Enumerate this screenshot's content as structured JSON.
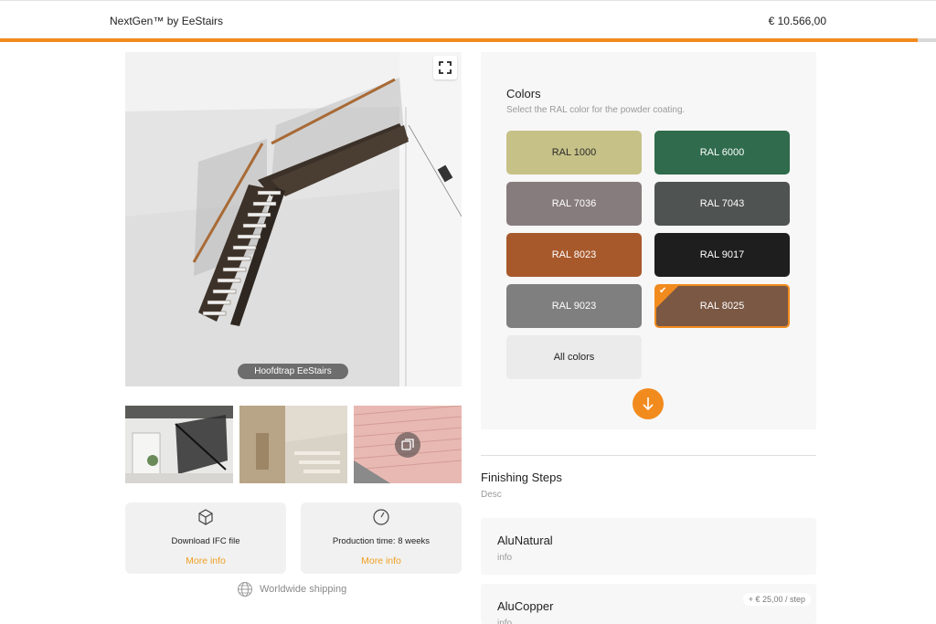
{
  "header": {
    "brand": "NextGen™ by EeStairs",
    "price": "€ 10.566,00",
    "progress_percent": 98
  },
  "viewer": {
    "label": "Hoofdtrap EeStairs",
    "fullscreen_icon": "expand-icon"
  },
  "thumbnails": [
    {
      "name": "thumbnail-interior-staircase"
    },
    {
      "name": "thumbnail-lobby-staircase"
    },
    {
      "name": "thumbnail-pink-detail",
      "icon": "gallery-icon"
    }
  ],
  "info_cards": [
    {
      "icon": "cube-icon",
      "label": "Download IFC file",
      "link": "More info"
    },
    {
      "icon": "clock-icon",
      "label": "Production time: 8 weeks",
      "link": "More info"
    }
  ],
  "shipping": {
    "icon": "globe-icon",
    "text": "Worldwide shipping"
  },
  "colors": {
    "title": "Colors",
    "subtitle": "Select the RAL color for the powder coating.",
    "swatches": [
      {
        "label": "RAL 1000",
        "color": "#c6c187",
        "text_color": "#2a2a2a",
        "selected": false
      },
      {
        "label": "RAL 6000",
        "color": "#2f6b4c",
        "text_color": "#ffffff",
        "selected": false
      },
      {
        "label": "RAL 7036",
        "color": "#877c7d",
        "text_color": "#ffffff",
        "selected": false
      },
      {
        "label": "RAL 7043",
        "color": "#4f5352",
        "text_color": "#ffffff",
        "selected": false
      },
      {
        "label": "RAL 8023",
        "color": "#a8592c",
        "text_color": "#ffffff",
        "selected": false
      },
      {
        "label": "RAL 9017",
        "color": "#1e1e1e",
        "text_color": "#ffffff",
        "selected": false
      },
      {
        "label": "RAL 9023",
        "color": "#7f7f7f",
        "text_color": "#ffffff",
        "selected": false
      },
      {
        "label": "RAL 8025",
        "color": "#7a5844",
        "text_color": "#ffffff",
        "selected": true
      }
    ],
    "all_colors": {
      "label": "All colors",
      "color": "#ebebeb",
      "text_color": "#222222"
    },
    "accent": "#f28b1e",
    "scroll_down_icon": "arrow-down-icon"
  },
  "finishing": {
    "title": "Finishing Steps",
    "desc": "Desc",
    "options": [
      {
        "name": "AluNatural",
        "info": "info",
        "price": ""
      },
      {
        "name": "AluCopper",
        "info": "info",
        "price": "+ € 25,00 / step"
      }
    ]
  }
}
